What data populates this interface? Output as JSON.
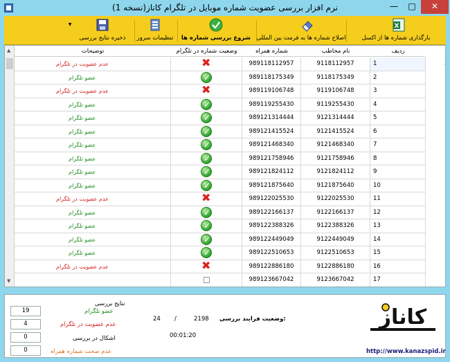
{
  "window": {
    "title": "نرم افزار بررسی عضویت شماره موبایل در تلگرام کاناز(نسخه 1)",
    "min_glyph": "—",
    "max_glyph": "□",
    "close_glyph": "✕"
  },
  "toolbar": {
    "import_excel": "بارگذاری شماره ها از اکسل",
    "fix_format": "اصلاح شماره ها به فرمت بین المللی",
    "start_check": "شروع بررسی شماره ها",
    "server_settings": "تنظیمات سرور",
    "save_results": "ذخیره نتایج بررسی",
    "dropdown_arrow": "▼"
  },
  "grid": {
    "headers": {
      "row": "ردیف",
      "name": "نام مخاطب",
      "phone": "شماره همراه",
      "status": "وضعیت شماره در تلگرام",
      "desc": "توضیحات"
    },
    "member_text": "عضو تلگرام",
    "non_member_text": "عدم عضویت در تلگرام",
    "selected_marker": "◀",
    "rows": [
      {
        "row": "1",
        "name": "9118112957",
        "phone": "989118112957",
        "member": false
      },
      {
        "row": "2",
        "name": "9118175349",
        "phone": "989118175349",
        "member": true
      },
      {
        "row": "3",
        "name": "9119106748",
        "phone": "989119106748",
        "member": false
      },
      {
        "row": "4",
        "name": "9119255430",
        "phone": "989119255430",
        "member": true
      },
      {
        "row": "5",
        "name": "9121314444",
        "phone": "989121314444",
        "member": true
      },
      {
        "row": "6",
        "name": "9121415524",
        "phone": "989121415524",
        "member": true
      },
      {
        "row": "7",
        "name": "9121468340",
        "phone": "989121468340",
        "member": true
      },
      {
        "row": "8",
        "name": "9121758946",
        "phone": "989121758946",
        "member": true
      },
      {
        "row": "9",
        "name": "9121824112",
        "phone": "989121824112",
        "member": true
      },
      {
        "row": "10",
        "name": "9121875640",
        "phone": "989121875640",
        "member": true
      },
      {
        "row": "11",
        "name": "9122025530",
        "phone": "989122025530",
        "member": false
      },
      {
        "row": "12",
        "name": "9122166137",
        "phone": "989122166137",
        "member": true
      },
      {
        "row": "13",
        "name": "9122388326",
        "phone": "989122388326",
        "member": true
      },
      {
        "row": "14",
        "name": "9122449049",
        "phone": "989122449049",
        "member": true
      },
      {
        "row": "15",
        "name": "9122510653",
        "phone": "989122510653",
        "member": true
      },
      {
        "row": "16",
        "name": "9122886180",
        "phone": "989122886180",
        "member": false
      },
      {
        "row": "17",
        "name": "9123667042",
        "phone": "989123667042",
        "member": null
      }
    ]
  },
  "results": {
    "heading": "نتایج بررسی",
    "members_label": "عضو تلگرام",
    "members_value": "19",
    "non_members_label": "عدم عضویت در تلگرام",
    "non_members_value": "4",
    "errors_label": "اشکال در بررسی",
    "errors_value": "0",
    "invalid_label": "عدم صحت شماره همراه",
    "invalid_value": "0"
  },
  "progress": {
    "label": "وضعیت فرایند بررسی:",
    "total": "2198",
    "separator": "/",
    "done": "24",
    "elapsed": "00:01:20"
  },
  "brand": {
    "logo_text": "کاناز",
    "url": "http://www.kanazspid.ir"
  },
  "colors": {
    "titlebar": "#8ed6ec",
    "toolbar": "#f5cd1d",
    "member": "#1e8c1e",
    "non_member": "#d32020"
  }
}
